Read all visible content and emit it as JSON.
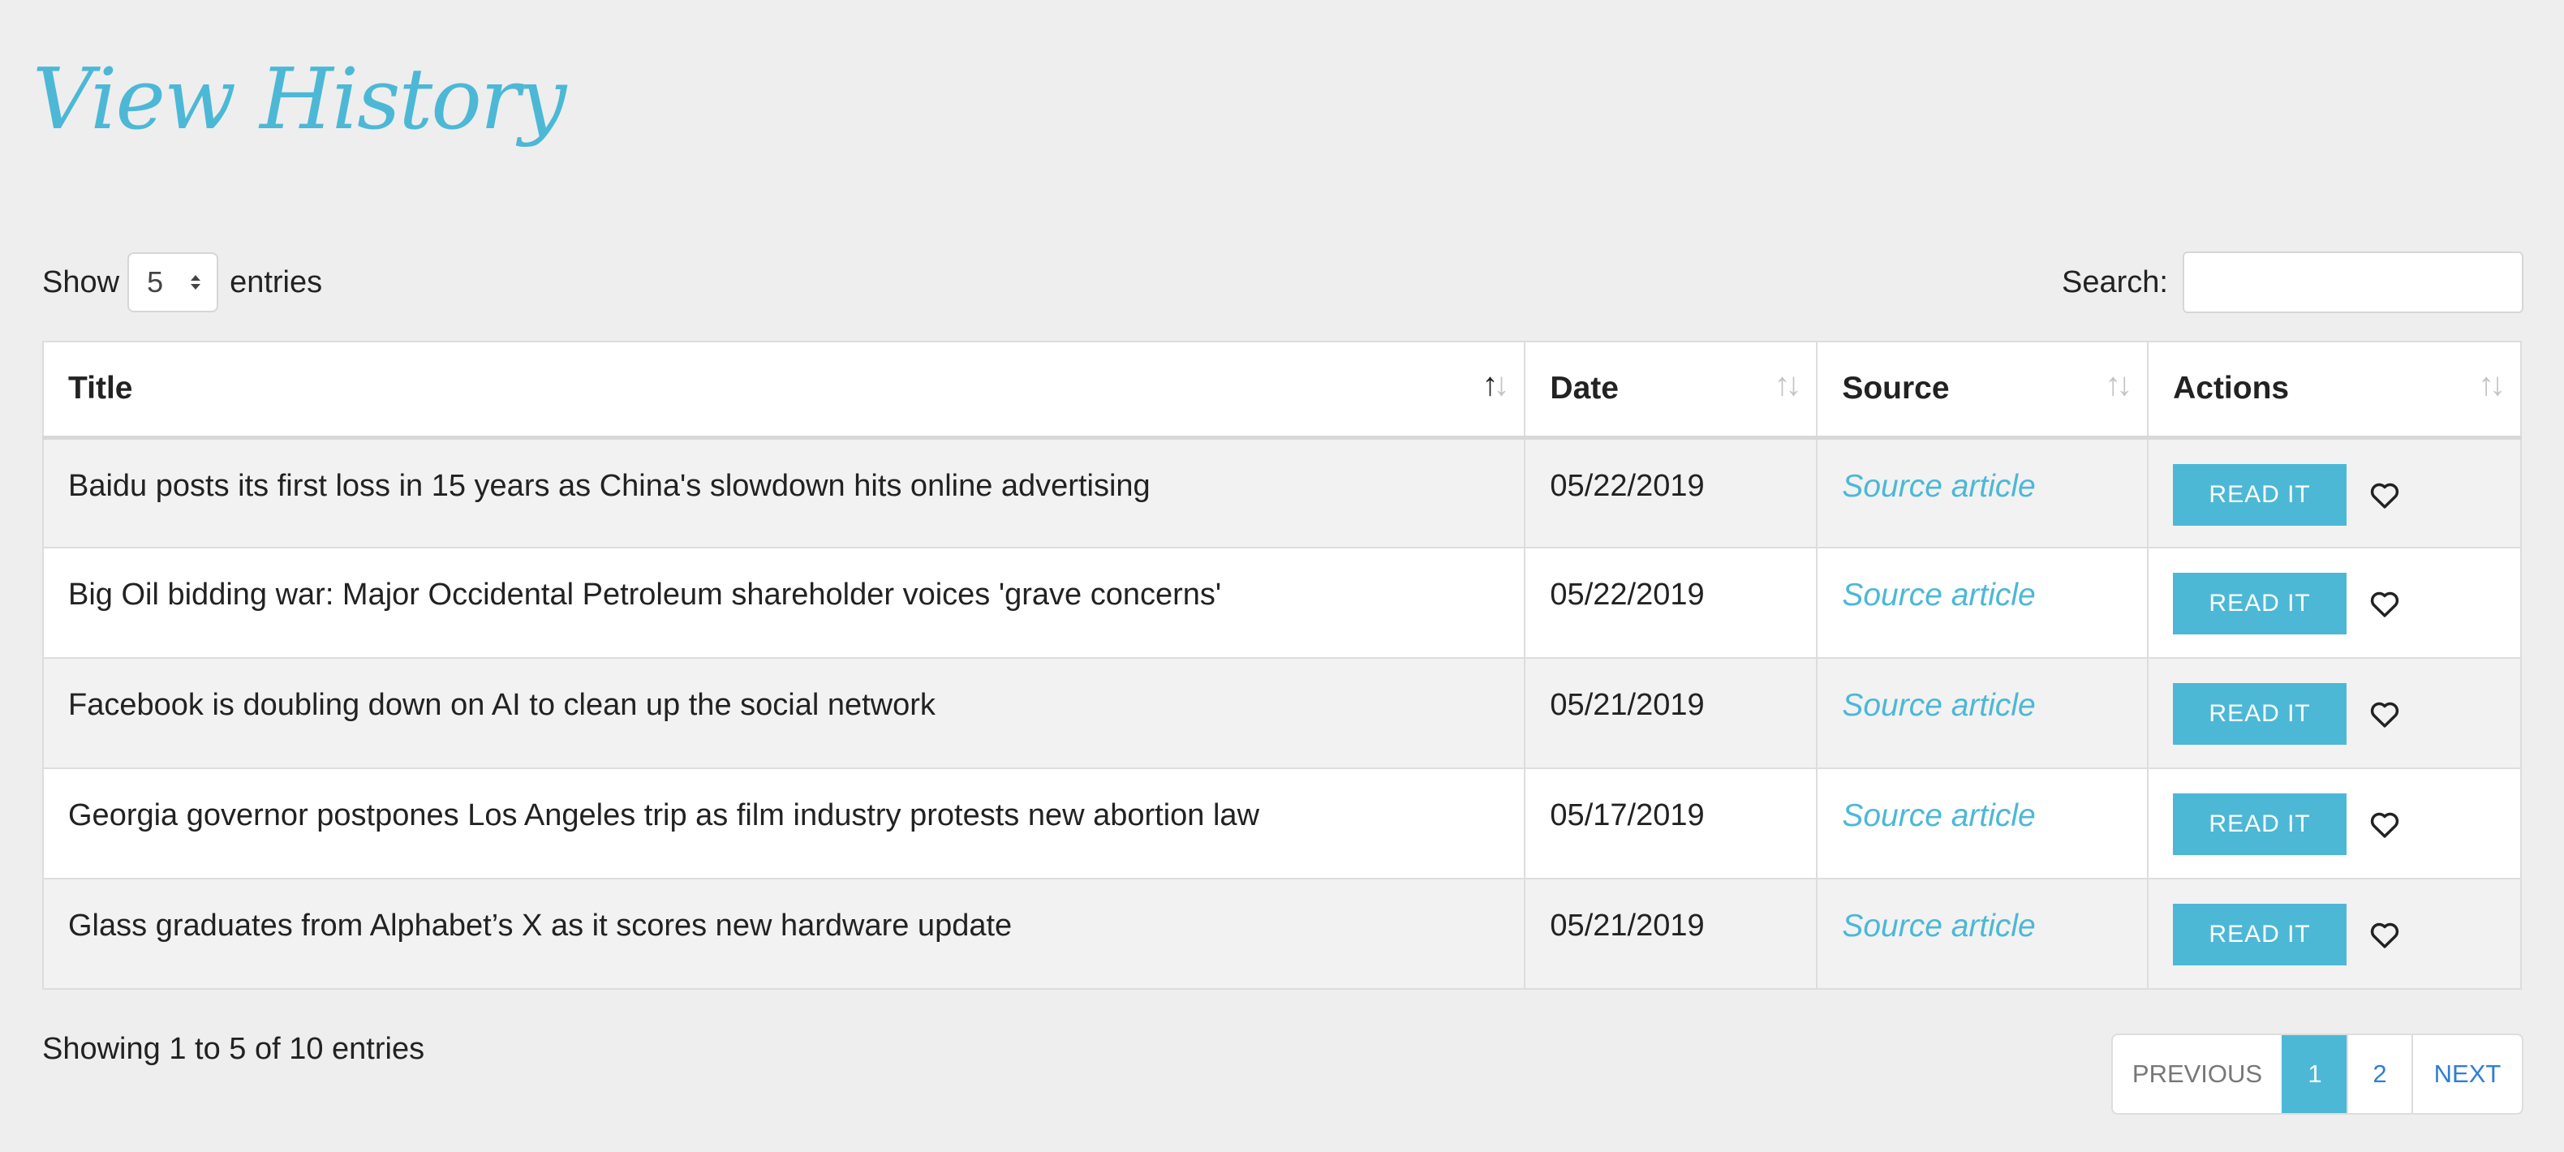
{
  "page": {
    "title": "View History"
  },
  "length_control": {
    "show_label": "Show",
    "selected": "5",
    "entries_label": "entries"
  },
  "search": {
    "label": "Search:",
    "value": "",
    "placeholder": ""
  },
  "table": {
    "columns": [
      "Title",
      "Date",
      "Source",
      "Actions"
    ],
    "rows": [
      {
        "title": "Baidu posts its first loss in 15 years as China's slowdown hits online advertising",
        "date": "05/22/2019",
        "source": "Source article",
        "action": "READ IT"
      },
      {
        "title": "Big Oil bidding war: Major Occidental Petroleum shareholder voices 'grave concerns'",
        "date": "05/22/2019",
        "source": "Source article",
        "action": "READ IT"
      },
      {
        "title": "Facebook is doubling down on AI to clean up the social network",
        "date": "05/21/2019",
        "source": "Source article",
        "action": "READ IT"
      },
      {
        "title": "Georgia governor postpones Los Angeles trip as film industry protests new abortion law",
        "date": "05/17/2019",
        "source": "Source article",
        "action": "READ IT"
      },
      {
        "title": "Glass graduates from Alphabet’s X as it scores new hardware update",
        "date": "05/21/2019",
        "source": "Source article",
        "action": "READ IT"
      }
    ]
  },
  "footer": {
    "info": "Showing 1 to 5 of 10 entries"
  },
  "pagination": {
    "previous": "PREVIOUS",
    "pages": [
      "1",
      "2"
    ],
    "current": "1",
    "next": "NEXT"
  },
  "icons": {
    "sort": "sort-icon",
    "favorite": "heart-icon",
    "select_arrows": "select-arrows-icon"
  },
  "colors": {
    "accent": "#4cb8d6",
    "link": "#2f7fd4",
    "background": "#eeeeee"
  }
}
